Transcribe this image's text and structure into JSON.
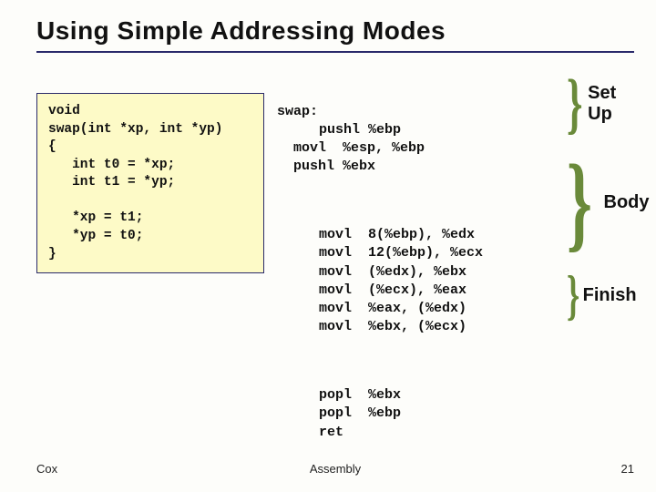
{
  "title": "Using Simple Addressing Modes",
  "c_code": "void\nswap(int *xp, int *yp)\n{\n   int t0 = *xp;\n   int t1 = *yp;\n\n   *xp = t1;\n   *yp = t0;\n}",
  "asm": {
    "func_label": "swap:",
    "setup": "  pushl %ebp\n  movl  %esp, %ebp\n  pushl %ebx",
    "body": "  movl  8(%ebp), %edx\n  movl  12(%ebp), %ecx\n  movl  (%edx), %ebx\n  movl  (%ecx), %eax\n  movl  %eax, (%edx)\n  movl  %ebx, (%ecx)",
    "finish": "  popl  %ebx\n  popl  %ebp\n  ret"
  },
  "labels": {
    "setup": "Set Up",
    "body": "Body",
    "finish": "Finish"
  },
  "footer": {
    "left": "Cox",
    "center": "Assembly",
    "right": "21"
  }
}
